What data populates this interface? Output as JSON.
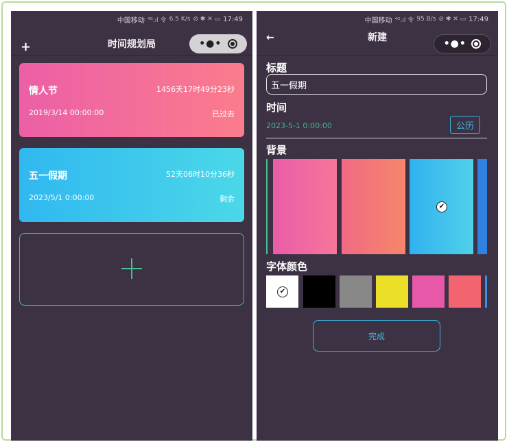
{
  "left": {
    "status": {
      "carrier": "中国移动",
      "signal": "⁴ᴳ.ıl 令",
      "speed": "6.5 K/s",
      "icons": "⊘ ✱ ✕ ▭",
      "time": "17:49"
    },
    "nav": {
      "title": "时间规划局",
      "add_label": "+"
    },
    "cards": [
      {
        "name": "情人节",
        "remaining": "1456天17时49分23秒",
        "date": "2019/3/14 00:00:00",
        "state": "已过去",
        "gradient": [
          "#ec5fa7",
          "#fb7c8c"
        ]
      },
      {
        "name": "五一假期",
        "remaining": "52天06时10分36秒",
        "date": "2023/5/1 0:00:00",
        "state": "剩余",
        "gradient": [
          "#30b8f0",
          "#4bd8e8"
        ]
      }
    ]
  },
  "right": {
    "status": {
      "carrier": "中国移动",
      "signal": "⁴ᴳ.ıl 令",
      "speed": "95 B/s",
      "icons": "⊘ ✱ ✕ ▭",
      "time": "17:49"
    },
    "nav": {
      "title": "新建",
      "back_label": "←"
    },
    "form": {
      "title_label": "标题",
      "title_value": "五一假期",
      "time_label": "时间",
      "time_value": "2023-5-1 0:00:00",
      "calendar_button": "公历",
      "background_label": "背景",
      "font_color_label": "字体颜色",
      "done_button": "完成",
      "background_swatches": [
        {
          "gradient": [
            "#ea5ca8",
            "#f7769a"
          ],
          "selected": false
        },
        {
          "gradient": [
            "#f16a83",
            "#f6866a"
          ],
          "selected": false
        },
        {
          "gradient": [
            "#32b1f0",
            "#4fd1ea"
          ],
          "selected": true
        },
        {
          "gradient": [
            "#2f7fe0",
            "#3a96e8"
          ],
          "selected": false
        }
      ],
      "font_colors": [
        {
          "color": "#ffffff",
          "selected": true
        },
        {
          "color": "#000000",
          "selected": false
        },
        {
          "color": "#888888",
          "selected": false
        },
        {
          "color": "#ebdf28",
          "selected": false
        },
        {
          "color": "#e858a8",
          "selected": false
        },
        {
          "color": "#f26570",
          "selected": false
        },
        {
          "color": "#3b8de6",
          "selected": false
        }
      ],
      "check_glyph": "✔"
    }
  },
  "colors": {
    "background": "#3c3243",
    "accent_green": "#45c196",
    "accent_blue": "#3cb7e4"
  }
}
